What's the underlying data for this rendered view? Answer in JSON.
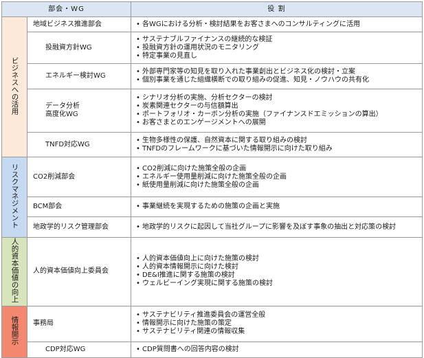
{
  "header": {
    "dept_col": "部会・WG",
    "role_col": "役 割"
  },
  "categories": [
    {
      "label": "ビジネスへの活用"
    },
    {
      "label": "リスクマネジメント"
    },
    {
      "label": "人的資本価値の向上"
    },
    {
      "label": "情報開示"
    }
  ],
  "rows": [
    {
      "dept": "地域ビジネス推進部会",
      "roles": [
        "各WGにおける分析・検討結果をお客さまへのコンサルティングに活用"
      ]
    },
    {
      "dept": "投融資方針WG",
      "roles": [
        "サステナブルファイナンスの継続的な検証",
        "投融資方針の運用状況のモニタリング",
        "特定事業の見直し"
      ]
    },
    {
      "dept": "エネルギー検討WG",
      "roles": [
        "外部専門家等の知見を取り入れた事業創出とビジネス化の検討・立案",
        "個別事業を通じた組織横断での取り組みの促進、知見・ノウハウの共有化"
      ]
    },
    {
      "dept": "データ分析",
      "dept2": "高度化WG",
      "roles": [
        "シナリオ分析の実施、分析セクターの検討",
        "炭素関連セクターの与信額算出",
        "ポートフォリオ・カーボン分析の実施（ファイナンスドエミッションの算出）",
        "お客さまとのエンゲージメントへの展開"
      ]
    },
    {
      "dept": "TNFD対応WG",
      "roles": [
        "生物多様性の保護、自然資本に関する取り組みの検討",
        "TNFDのフレームワークに基づいた情報開示に向けた取り組み"
      ]
    },
    {
      "dept": "CO2削減部会",
      "roles": [
        "CO2削減に向けた施策全般の企画",
        "エネルギー使用量削減に向けた施策全般の企画",
        "紙使用量削減に向けた施策全般の企画"
      ]
    },
    {
      "dept": "BCM部会",
      "roles": [
        "事業継続を実現するための施策の企画と実施"
      ]
    },
    {
      "dept": "地政学的リスク管理部会",
      "roles": [
        "地政学的リスクに起因して当社グループに影響を及ぼす事象の抽出と対応策の検討"
      ]
    },
    {
      "dept": "人的資本価値向上委員会",
      "roles": [
        "人的資本価値向上に向けた施策の検討",
        "人的資本情報開示に向けた検討",
        "DE&I推進に関する施策の検討",
        "ウェルビーイング実現に関する施策の検討"
      ]
    },
    {
      "dept": "事務局",
      "roles": [
        "サステナビリティ推進委員会の運営全般",
        "情報開示に向けた施策の策定",
        "サステナビリティ関連の情報収集"
      ]
    },
    {
      "dept": "CDP対応WG",
      "roles": [
        "CDP質問書への回答内容の検討"
      ]
    }
  ]
}
